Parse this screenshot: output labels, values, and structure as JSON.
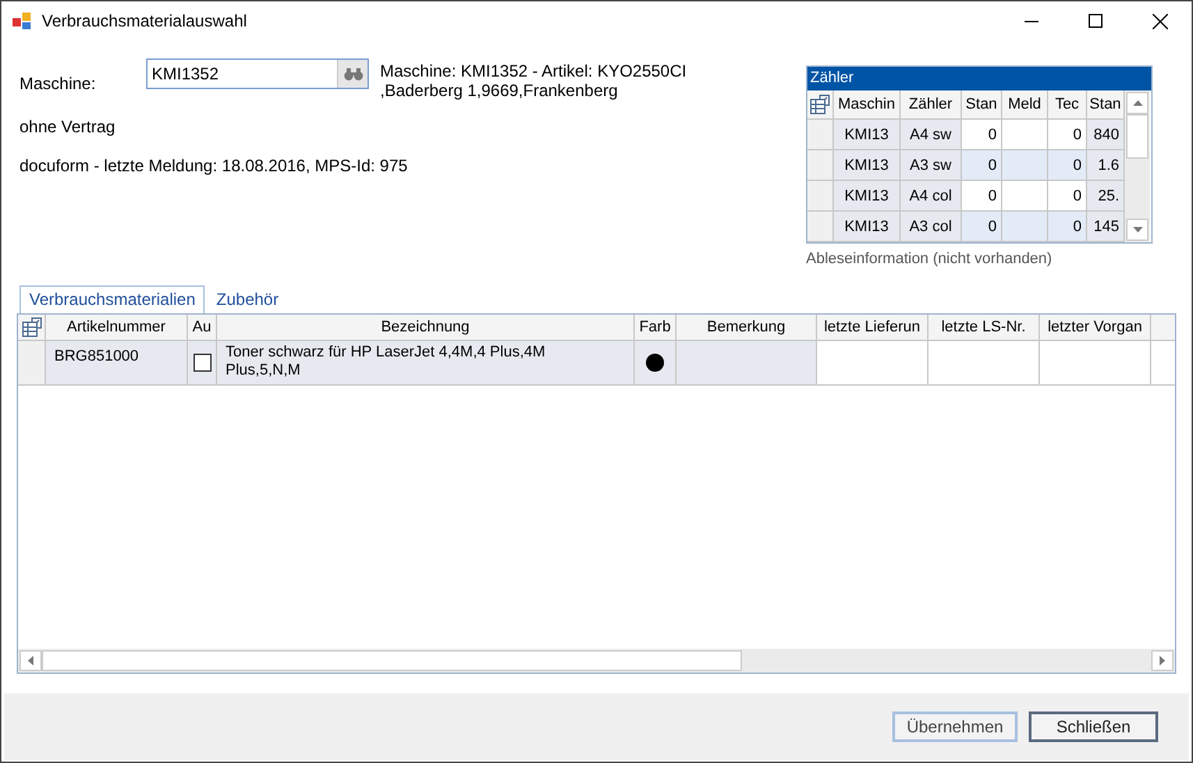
{
  "window": {
    "title": "Verbrauchsmaterialauswahl"
  },
  "machine": {
    "label": "Maschine:",
    "value": "KMI1352",
    "info_line_1": "Maschine: KMI1352 - Artikel: KYO2550CI",
    "info_line_2": ",Baderberg 1,9669,Frankenberg"
  },
  "contract": "ohne Vertrag",
  "report": "docuform - letzte Meldung: 18.08.2016, MPS-Id: 975",
  "counters": {
    "title": "Zähler",
    "columns": [
      "Maschin",
      "Zähler",
      "Stan",
      "Meld",
      "Tec",
      "Stan"
    ],
    "rows": [
      [
        "KMI13",
        "A4 sw",
        "0",
        "",
        "0",
        "840"
      ],
      [
        "KMI13",
        "A3 sw",
        "0",
        "",
        "0",
        "1.6"
      ],
      [
        "KMI13",
        "A4 col",
        "0",
        "",
        "0",
        "25."
      ],
      [
        "KMI13",
        "A3 col",
        "0",
        "",
        "0",
        "145"
      ]
    ],
    "caption": "Ableseinformation (nicht vorhanden)"
  },
  "tabs": [
    {
      "label": "Verbrauchsmaterialien",
      "selected": true
    },
    {
      "label": "Zubehör",
      "selected": false
    }
  ],
  "table": {
    "columns": [
      "Artikelnummer",
      "Au",
      "Bezeichnung",
      "Farb",
      "Bemerkung",
      "letzte Lieferun",
      "letzte LS-Nr.",
      "letzter Vorgan"
    ],
    "rows": [
      {
        "article": "BRG851000",
        "checked": false,
        "description": "Toner schwarz für HP LaserJet 4,4M,4 Plus,4M Plus,5,N,M",
        "color": "#000000"
      }
    ]
  },
  "buttons": [
    {
      "label": "Übernehmen",
      "default": false
    },
    {
      "label": "Schließen",
      "default": true
    }
  ]
}
